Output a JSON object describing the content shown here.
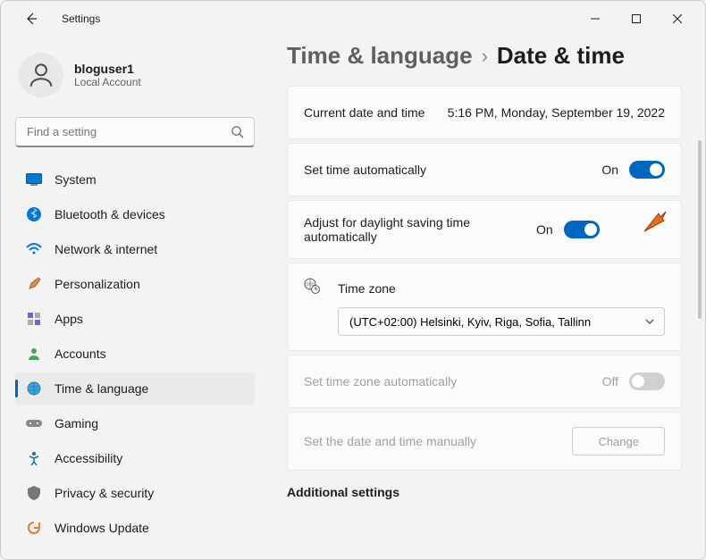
{
  "window": {
    "title": "Settings"
  },
  "user": {
    "name": "bloguser1",
    "subtitle": "Local Account"
  },
  "search": {
    "placeholder": "Find a setting"
  },
  "nav": [
    {
      "label": "System"
    },
    {
      "label": "Bluetooth & devices"
    },
    {
      "label": "Network & internet"
    },
    {
      "label": "Personalization"
    },
    {
      "label": "Apps"
    },
    {
      "label": "Accounts"
    },
    {
      "label": "Time & language"
    },
    {
      "label": "Gaming"
    },
    {
      "label": "Accessibility"
    },
    {
      "label": "Privacy & security"
    },
    {
      "label": "Windows Update"
    }
  ],
  "breadcrumb": {
    "parent": "Time & language",
    "current": "Date & time"
  },
  "cards": {
    "currentLabel": "Current date and time",
    "currentValue": "5:16 PM, Monday, September 19, 2022",
    "setAutoLabel": "Set time automatically",
    "setAutoState": "On",
    "dstLabel": "Adjust for daylight saving time automatically",
    "dstState": "On",
    "tzLabel": "Time zone",
    "tzValue": "(UTC+02:00) Helsinki, Kyiv, Riga, Sofia, Tallinn",
    "tzAutoLabel": "Set time zone automatically",
    "tzAutoState": "Off",
    "manualLabel": "Set the date and time manually",
    "changeLabel": "Change"
  },
  "sectionHeading": "Additional settings",
  "colors": {
    "accent": "#0067c0"
  }
}
